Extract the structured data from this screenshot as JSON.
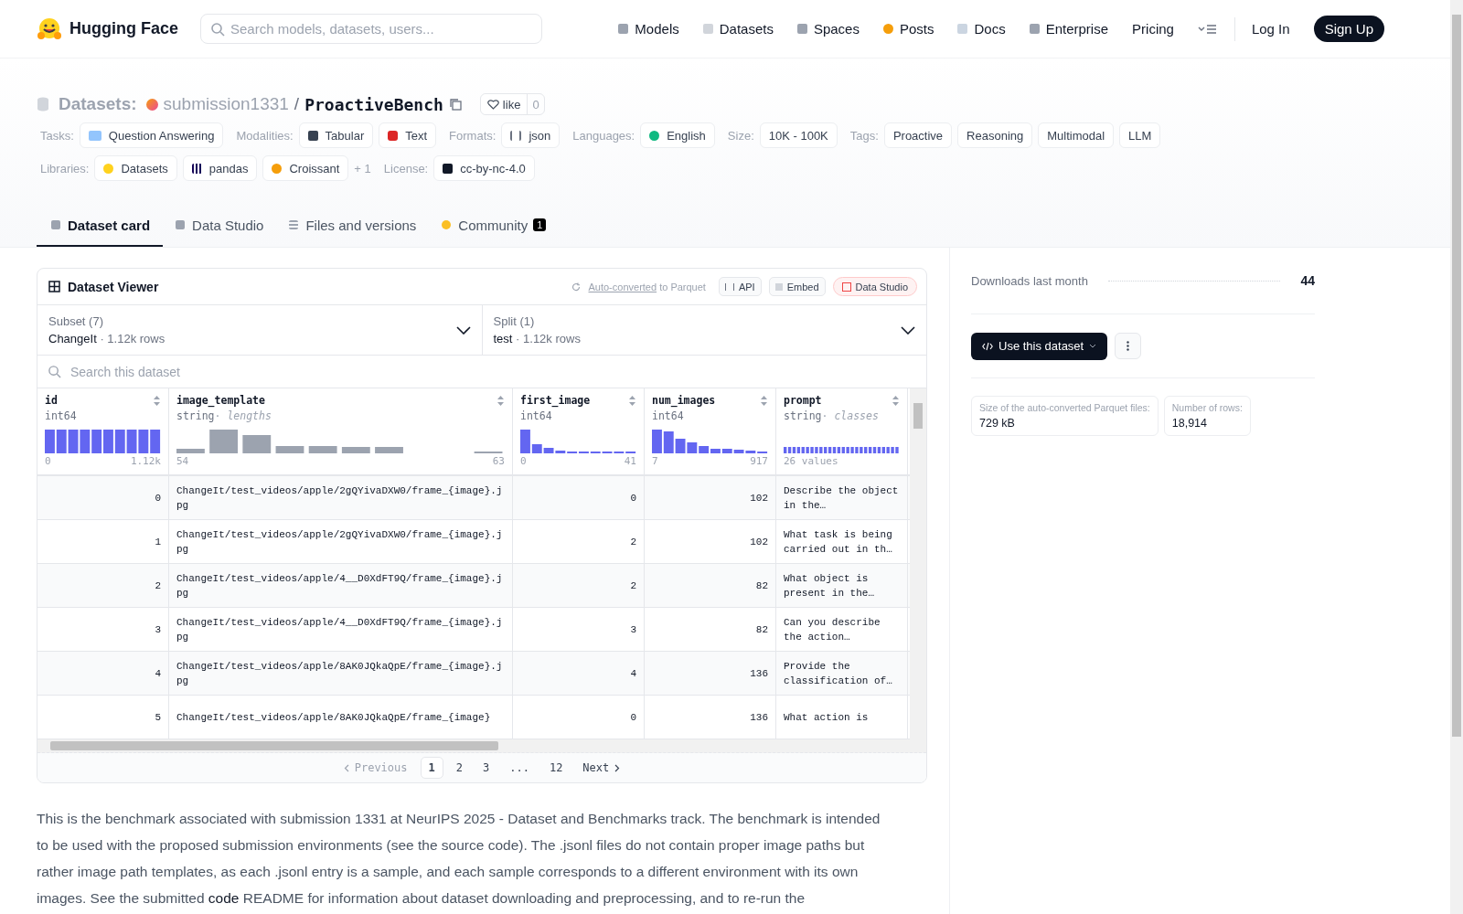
{
  "header": {
    "brand": "Hugging Face",
    "search": {
      "placeholder": "Search models, datasets, users..."
    },
    "nav": [
      {
        "label": "Models"
      },
      {
        "label": "Datasets"
      },
      {
        "label": "Spaces"
      },
      {
        "label": "Posts"
      },
      {
        "label": "Docs"
      },
      {
        "label": "Enterprise"
      },
      {
        "label": "Pricing"
      }
    ],
    "login": "Log In",
    "signup": "Sign Up"
  },
  "repo": {
    "section": "Datasets:",
    "owner": "submission1331",
    "separator": "/",
    "name": "ProactiveBench",
    "like": "like",
    "likes": "0"
  },
  "meta_rows": [
    [
      {
        "label": "Tasks:",
        "chips": [
          "Question Answering"
        ]
      },
      {
        "label": "Modalities:",
        "chips": [
          "Tabular",
          "Text"
        ]
      },
      {
        "label": "Formats:",
        "chips": [
          "json"
        ]
      },
      {
        "label": "Languages:",
        "chips": [
          "English"
        ]
      },
      {
        "label": "Size:",
        "chips": [
          "10K - 100K"
        ]
      },
      {
        "label": "Tags:",
        "chips": [
          "Proactive",
          "Reasoning",
          "Multimodal",
          "LLM"
        ]
      }
    ],
    [
      {
        "label": "Libraries:",
        "chips": [
          "Datasets",
          "pandas",
          "Croissant"
        ],
        "more": "+ 1"
      },
      {
        "label": "License:",
        "chips": [
          "cc-by-nc-4.0"
        ]
      }
    ]
  ],
  "tabs": [
    {
      "label": "Dataset card",
      "selected": true
    },
    {
      "label": "Data Studio",
      "selected": false
    },
    {
      "label": "Files and versions",
      "selected": false
    },
    {
      "label": "Community",
      "selected": false,
      "badge": "1"
    }
  ],
  "viewer": {
    "title": "Dataset Viewer",
    "converted_link": "Auto-converted",
    "converted_rest": "to Parquet",
    "buttons": [
      "API",
      "Embed",
      "Data Studio"
    ],
    "subset": {
      "label": "Subset (7)",
      "value": "ChangeIt",
      "dot": "·",
      "rows": "1.12k rows"
    },
    "split": {
      "label": "Split (1)",
      "value": "test",
      "dot": "·",
      "rows": "1.12k rows"
    },
    "search": {
      "placeholder": "Search this dataset"
    },
    "columns": [
      {
        "name": "id",
        "type": "int64",
        "kind": "numeric",
        "color": "#6366f1",
        "min": "0",
        "max": "1.12k"
      },
      {
        "name": "image_template",
        "type": "string",
        "dot": "·",
        "type_note": "lengths",
        "kind": "lengths",
        "color": "#9ca3af",
        "min": "54",
        "max": "63"
      },
      {
        "name": "first_image",
        "type": "int64",
        "kind": "numeric",
        "color": "#6366f1",
        "min": "0",
        "max": "41"
      },
      {
        "name": "num_images",
        "type": "int64",
        "kind": "numeric",
        "color": "#6366f1",
        "min": "7",
        "max": "917"
      },
      {
        "name": "prompt",
        "type": "string",
        "dot": "·",
        "type_note": "classes",
        "kind": "classes",
        "color": "#6366f1",
        "min": "26 values"
      }
    ],
    "rows": [
      [
        "0",
        "ChangeIt/test_videos/apple/2gQYivaDXW0/frame_{image}.jpg",
        "0",
        "102",
        "Describe the object in the…"
      ],
      [
        "1",
        "ChangeIt/test_videos/apple/2gQYivaDXW0/frame_{image}.jpg",
        "2",
        "102",
        "What task is being carried out in th…"
      ],
      [
        "2",
        "ChangeIt/test_videos/apple/4__D0XdFT9Q/frame_{image}.jpg",
        "2",
        "82",
        "What object is present in the…"
      ],
      [
        "3",
        "ChangeIt/test_videos/apple/4__D0XdFT9Q/frame_{image}.jpg",
        "3",
        "82",
        "Can you describe the action…"
      ],
      [
        "4",
        "ChangeIt/test_videos/apple/8AK0JQkaQpE/frame_{image}.jpg",
        "4",
        "136",
        "Provide the classification of…"
      ],
      [
        "5",
        "ChangeIt/test_videos/apple/8AK0JQkaQpE/frame_{image}",
        "0",
        "136",
        "What action is"
      ]
    ],
    "pagination": {
      "previous": "Previous",
      "next": "Next",
      "pages": [
        {
          "label": "1",
          "selected": true
        },
        {
          "label": "2",
          "selected": false
        },
        {
          "label": "3",
          "selected": false
        },
        {
          "label": "...",
          "selected": false
        },
        {
          "label": "12",
          "selected": false
        }
      ]
    }
  },
  "description": {
    "before": "This is the benchmark associated with submission 1331 at NeurIPS 2025 - Dataset and Benchmarks track. The benchmark is intended to be used with the proposed submission environments (see the source code). The .jsonl files do not contain proper image paths but rather image path templates, as each .jsonl entry is a sample, and each sample corresponds to a different environment with its own images. See the submitted ",
    "link": "code",
    "after": " README for information about dataset downloading and preprocessing, and to re-run the"
  },
  "sidebar": {
    "downloads_label": "Downloads last month",
    "downloads": "44",
    "use_button": "Use this dataset",
    "stats": [
      {
        "label": "Size of the auto-converted Parquet files:",
        "value": "729 kB"
      },
      {
        "label": "Number of rows:",
        "value": "18,914"
      }
    ]
  }
}
